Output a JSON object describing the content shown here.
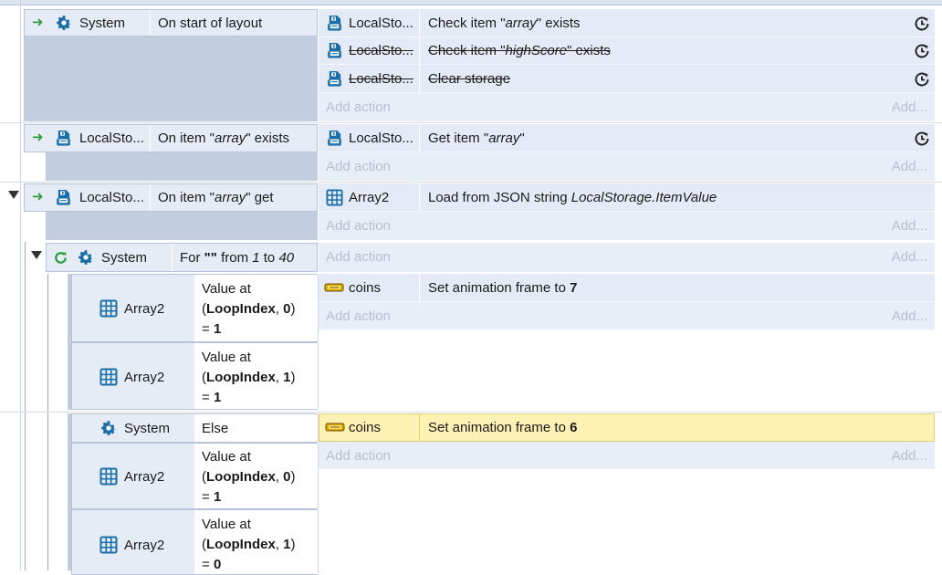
{
  "events": [
    {
      "id": "ev1",
      "condition": {
        "object": "System",
        "text_parts": [
          "On start of layout"
        ]
      },
      "actions": [
        {
          "object": "LocalSto...",
          "text": "Check item \"",
          "param": "array",
          "text_after": "\" exists",
          "disabled": false
        },
        {
          "object": "LocalSto...",
          "text": "Check item \"",
          "param": "highScore",
          "text_after": "\" exists",
          "disabled": true
        },
        {
          "object": "LocalSto...",
          "text": "Clear storage",
          "param": "",
          "text_after": "",
          "disabled": true
        }
      ],
      "add_action": "Add action",
      "add_short": "Add..."
    },
    {
      "id": "ev2",
      "condition": {
        "object": "LocalSto...",
        "text_before": "On item \"",
        "param": "array",
        "text_after": "\" exists"
      },
      "actions": [
        {
          "object": "LocalSto...",
          "text": "Get item \"",
          "param": "array",
          "text_after": "\""
        }
      ],
      "add_action": "Add action",
      "add_short": "Add..."
    },
    {
      "id": "ev3",
      "condition": {
        "object": "LocalSto...",
        "text_before": "On item \"",
        "param": "array",
        "text_after": "\" get"
      },
      "actions": [
        {
          "object": "Array2",
          "text": "Load from JSON string ",
          "param": "LocalStorage.ItemValue"
        }
      ],
      "add_action": "Add action",
      "add_short": "Add..."
    },
    {
      "id": "ev4",
      "condition": {
        "object": "System",
        "text_before": "For ",
        "quoted": "\"\"",
        "from_label": " from ",
        "from": "1",
        "to_label": " to ",
        "to": "40"
      },
      "add_action": "Add action",
      "add_short": "Add..."
    },
    {
      "id": "ev5",
      "conditions": [
        {
          "object": "Array2",
          "line1": "Value at",
          "line2_open": "(",
          "line2_bold": "LoopIndex",
          "line2_sep": ", ",
          "line2_idx": "0",
          "line2_close": ")",
          "line3_eq": "= ",
          "line3_val": "1"
        },
        {
          "object": "Array2",
          "line1": "Value at",
          "line2_open": "(",
          "line2_bold": "LoopIndex",
          "line2_sep": ", ",
          "line2_idx": "1",
          "line2_close": ")",
          "line3_eq": "= ",
          "line3_val": "1"
        }
      ],
      "action": {
        "object": "coins",
        "text": "Set animation frame to ",
        "value": "7"
      },
      "add_action": "Add action",
      "add_short": "Add..."
    },
    {
      "id": "ev6",
      "else": {
        "object": "System",
        "text": "Else"
      },
      "conditions": [
        {
          "object": "Array2",
          "line1": "Value at",
          "line2_open": "(",
          "line2_bold": "LoopIndex",
          "line2_sep": ", ",
          "line2_idx": "0",
          "line2_close": ")",
          "line3_eq": "= ",
          "line3_val": "1"
        },
        {
          "object": "Array2",
          "line1": "Value at",
          "line2_open": "(",
          "line2_bold": "LoopIndex",
          "line2_sep": ", ",
          "line2_idx": "1",
          "line2_close": ")",
          "line3_eq": "= ",
          "line3_val": "0"
        }
      ],
      "action": {
        "object": "coins",
        "text": "Set animation frame to ",
        "value": "6"
      },
      "add_action": "Add action",
      "add_short": "Add..."
    }
  ],
  "colors": {
    "accent_green": "#2e9e3c",
    "icon_blue": "#1a6fa8",
    "highlight": "#fff1b3"
  },
  "icons": {
    "trigger": "green-arrow-icon",
    "system": "gear-icon",
    "localstorage": "floppy-disk-icon",
    "array": "grid-icon",
    "sprite": "sprite-icon",
    "loop": "loop-icon",
    "wait": "clock-icon"
  }
}
